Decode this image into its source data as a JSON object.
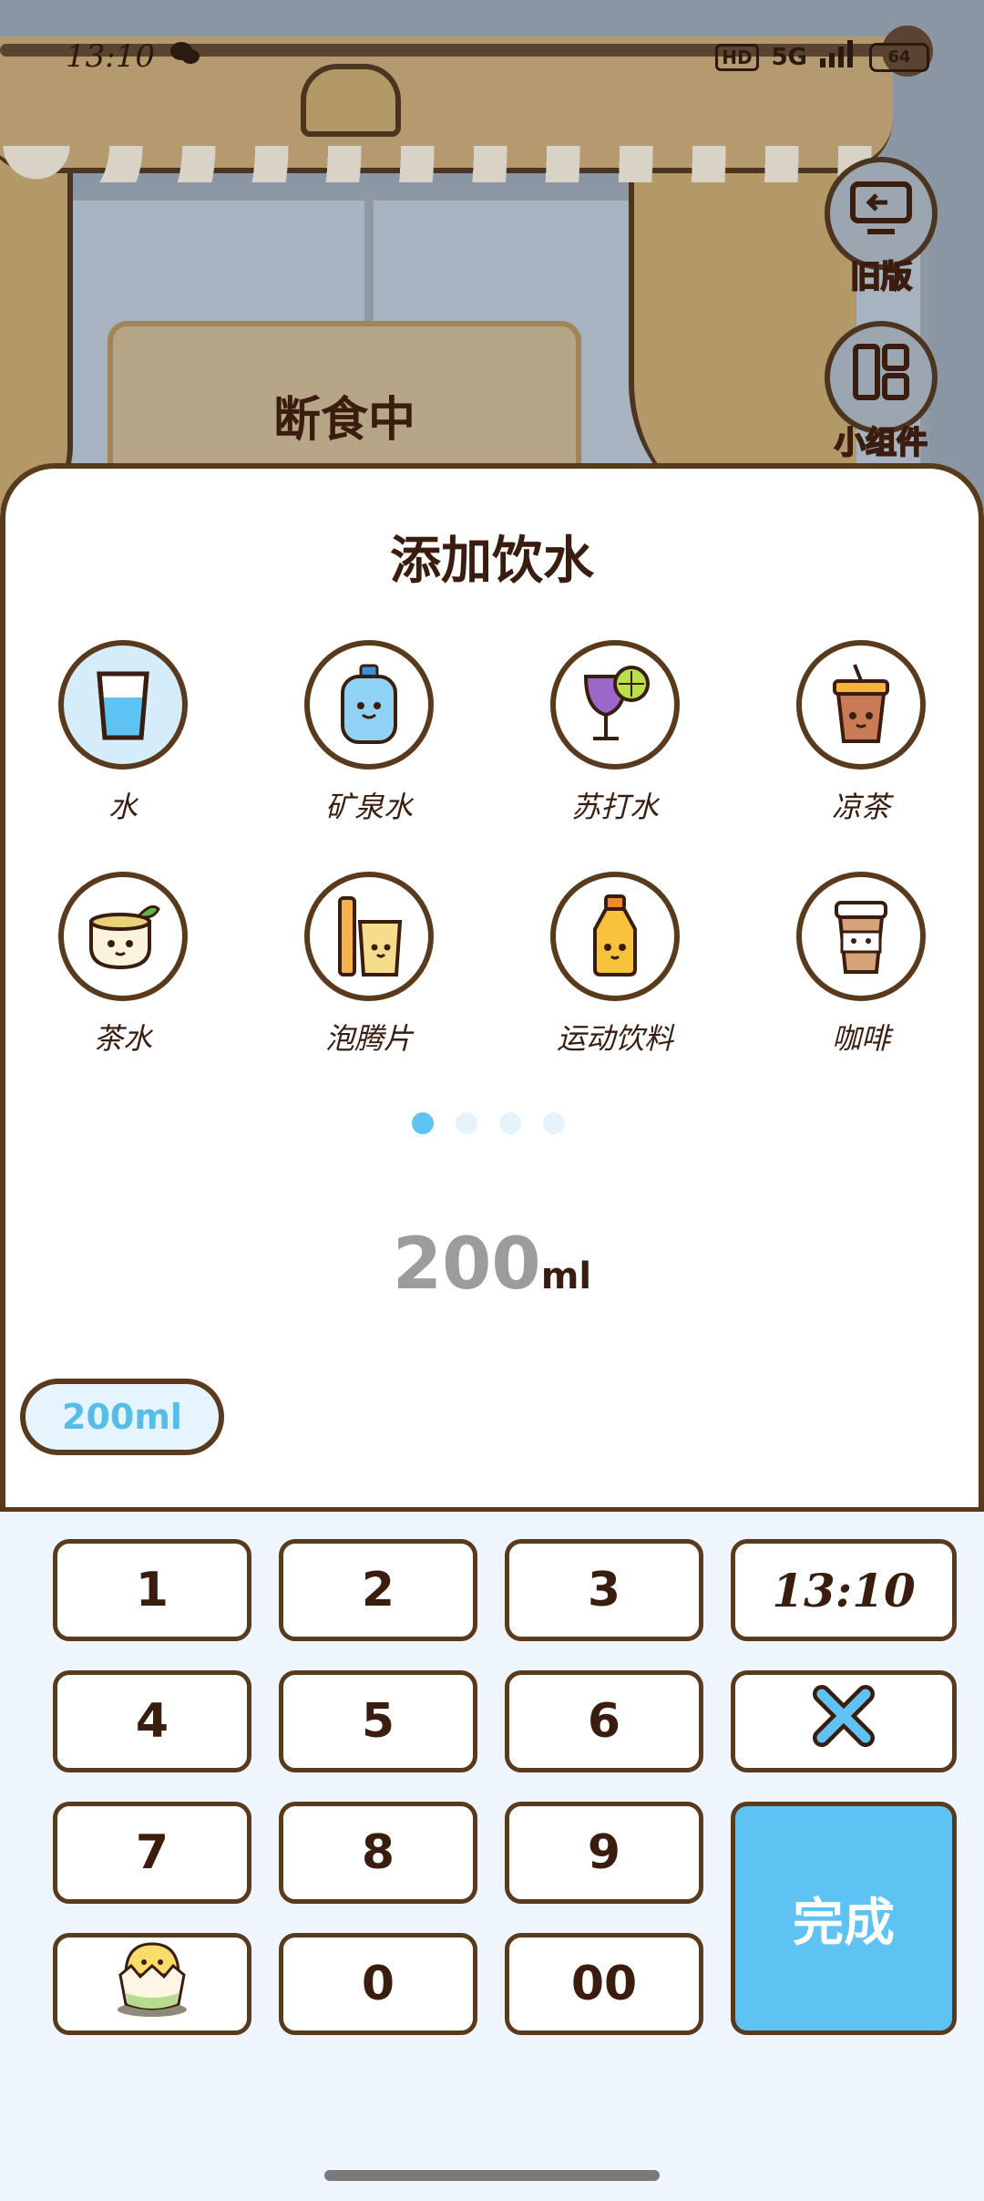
{
  "status_bar": {
    "time": "13:10",
    "network": "5G",
    "battery": "64",
    "hd": "HD"
  },
  "background": {
    "fasting_label": "断食中"
  },
  "side_buttons": [
    {
      "label": "旧版",
      "icon": "back-screen-icon"
    },
    {
      "label": "小组件",
      "icon": "widgets-icon"
    }
  ],
  "sheet": {
    "title": "添加饮水",
    "drinks": [
      {
        "label": "水",
        "icon": "water-glass-icon",
        "selected": true
      },
      {
        "label": "矿泉水",
        "icon": "water-jug-icon",
        "selected": false
      },
      {
        "label": "苏打水",
        "icon": "soda-glass-icon",
        "selected": false
      },
      {
        "label": "凉茶",
        "icon": "cold-tea-cup-icon",
        "selected": false
      },
      {
        "label": "茶水",
        "icon": "tea-bowl-icon",
        "selected": false
      },
      {
        "label": "泡腾片",
        "icon": "effervescent-tablet-icon",
        "selected": false
      },
      {
        "label": "运动饮料",
        "icon": "sports-drink-bottle-icon",
        "selected": false
      },
      {
        "label": "咖啡",
        "icon": "coffee-cup-icon",
        "selected": false
      }
    ],
    "page_count": 4,
    "active_page": 1,
    "amount_value": "200",
    "amount_unit": "ml",
    "preset": "200ml"
  },
  "keypad": {
    "keys": [
      "1",
      "2",
      "3",
      "13:10",
      "4",
      "5",
      "6",
      "7",
      "8",
      "9",
      "0",
      "00"
    ],
    "done_label": "完成",
    "backspace_icon": "close-x-icon",
    "mascot_icon": "chick-egg-icon"
  },
  "colors": {
    "accent": "#5ec3f3",
    "outline": "#5a3a1c",
    "text": "#3a1d0e"
  }
}
